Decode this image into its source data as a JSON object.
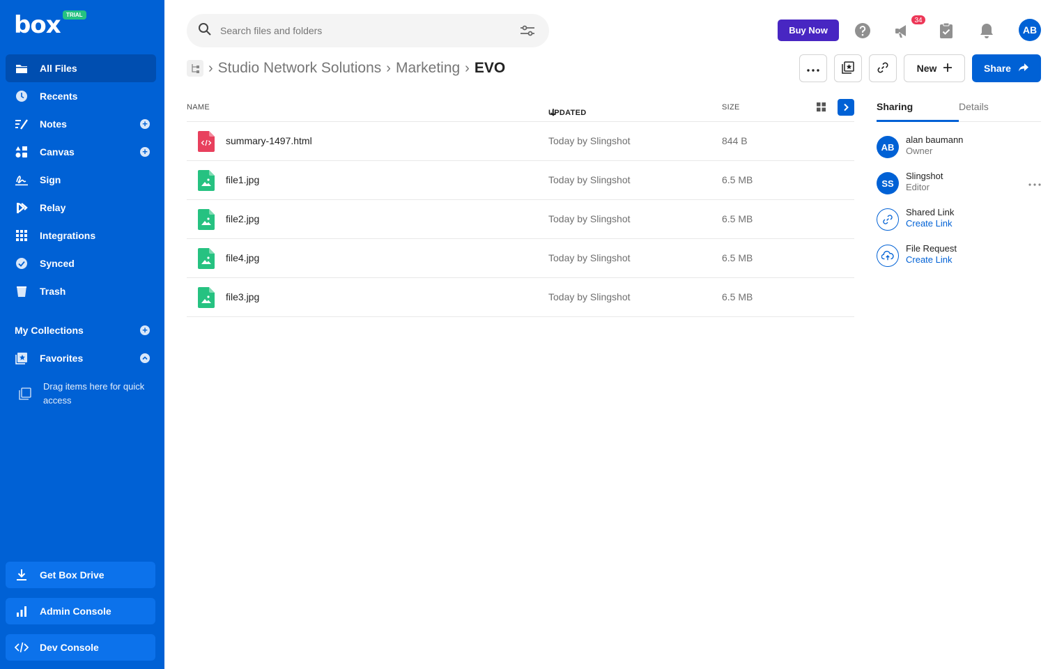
{
  "brand": {
    "logo": "box",
    "badge": "TRIAL"
  },
  "sidebar": {
    "items": [
      {
        "label": "All Files",
        "icon": "folder-icon"
      },
      {
        "label": "Recents",
        "icon": "clock-icon"
      },
      {
        "label": "Notes",
        "icon": "notes-icon"
      },
      {
        "label": "Canvas",
        "icon": "canvas-icon"
      },
      {
        "label": "Sign",
        "icon": "sign-icon"
      },
      {
        "label": "Relay",
        "icon": "relay-icon"
      },
      {
        "label": "Integrations",
        "icon": "grid-icon"
      },
      {
        "label": "Synced",
        "icon": "check-circle-icon"
      },
      {
        "label": "Trash",
        "icon": "trash-icon"
      }
    ],
    "collections_label": "My Collections",
    "favorites_label": "Favorites",
    "drag_hint": "Drag items here for quick access",
    "bottom": [
      {
        "label": "Get Box Drive",
        "icon": "download-icon"
      },
      {
        "label": "Admin Console",
        "icon": "bar-chart-icon"
      },
      {
        "label": "Dev Console",
        "icon": "code-icon"
      }
    ]
  },
  "search": {
    "placeholder": "Search files and folders"
  },
  "header": {
    "buy_now": "Buy Now",
    "notification_count": "34",
    "avatar_initials": "AB"
  },
  "breadcrumb": {
    "items": [
      "Studio Network Solutions",
      "Marketing"
    ],
    "current": "EVO"
  },
  "toolbar": {
    "new_label": "New",
    "share_label": "Share"
  },
  "list": {
    "columns": {
      "name": "NAME",
      "updated": "UPDATED",
      "size": "SIZE"
    },
    "rows": [
      {
        "name": "summary-1497.html",
        "updated": "Today by Slingshot",
        "size": "844 B",
        "type": "html"
      },
      {
        "name": "file1.jpg",
        "updated": "Today by Slingshot",
        "size": "6.5 MB",
        "type": "image"
      },
      {
        "name": "file2.jpg",
        "updated": "Today by Slingshot",
        "size": "6.5 MB",
        "type": "image"
      },
      {
        "name": "file4.jpg",
        "updated": "Today by Slingshot",
        "size": "6.5 MB",
        "type": "image"
      },
      {
        "name": "file3.jpg",
        "updated": "Today by Slingshot",
        "size": "6.5 MB",
        "type": "image"
      }
    ]
  },
  "panel": {
    "tabs": [
      "Sharing",
      "Details"
    ],
    "collaborators": [
      {
        "initials": "AB",
        "name": "alan baumann",
        "role": "Owner"
      },
      {
        "initials": "SS",
        "name": "Slingshot",
        "role": "Editor"
      }
    ],
    "shared_link": {
      "title": "Shared Link",
      "action": "Create Link"
    },
    "file_request": {
      "title": "File Request",
      "action": "Create Link"
    }
  },
  "colors": {
    "brand_blue": "#0061d5",
    "buy_now_purple": "#4826c2",
    "html_file_red": "#e8405d",
    "image_file_green": "#26c281",
    "badge_red": "#ed3757"
  }
}
